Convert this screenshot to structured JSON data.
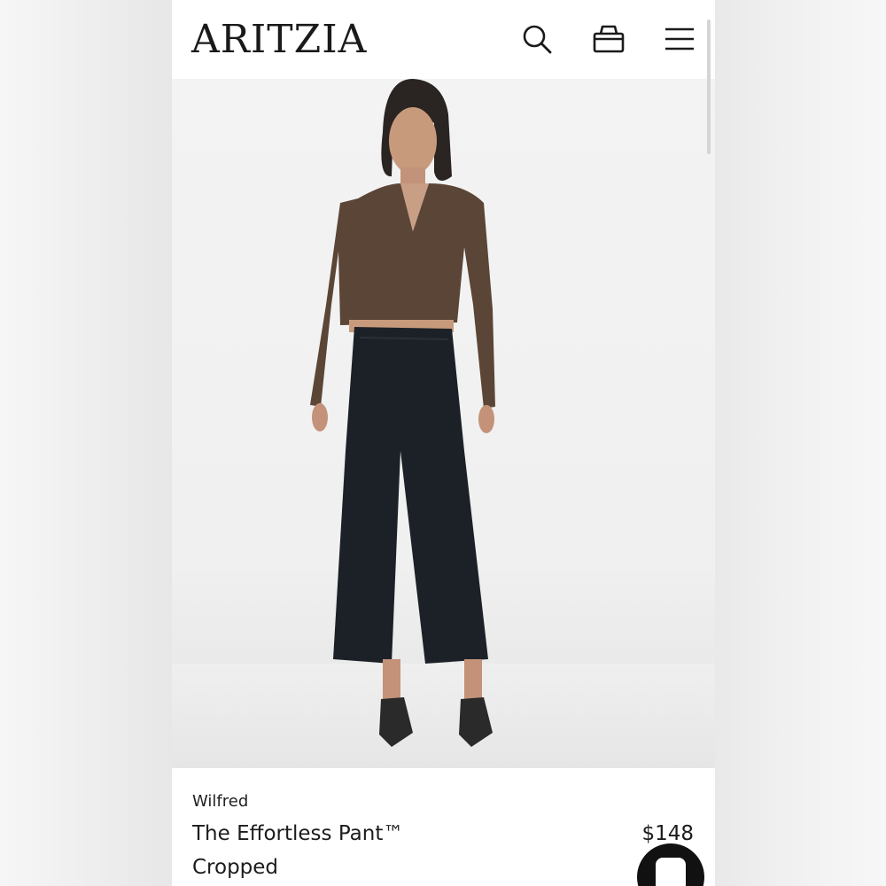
{
  "header": {
    "logo": "ARITZIA",
    "icons": {
      "search": "search-icon",
      "bag": "bag-icon",
      "menu": "menu-icon"
    }
  },
  "product": {
    "brand": "Wilfred",
    "name_line1": "The Effortless Pant™",
    "name_line2": "Cropped",
    "price": "$148"
  },
  "chat": {
    "icon": "chat-icon"
  },
  "colors": {
    "text": "#1c1c1c",
    "background": "#ffffff",
    "photo_background": "#f0f0f0",
    "chat_button": "#111111"
  }
}
